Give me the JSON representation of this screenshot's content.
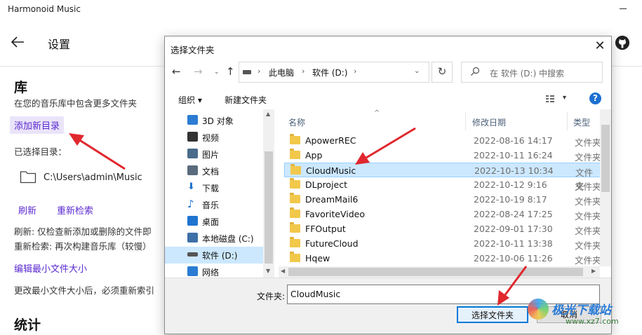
{
  "app": {
    "title": "Harmonoid Music",
    "page_title": "设置"
  },
  "library": {
    "heading": "库",
    "description": "在您的音乐库中包含更多文件夹",
    "add_button": "添加新目录",
    "selected_label": "已选择目录：",
    "directory_path": "C:\\Users\\admin\\Music",
    "refresh_button": "刷新",
    "rescan_button": "重新检索",
    "refresh_desc": "刷新: 仅检查新添加或删除的文件即",
    "rescan_desc": "重新检索: 再次构建音乐库（较慢）",
    "edit_min_button": "编辑最小文件大小",
    "min_desc": "更改最小文件大小后，必须重新索引",
    "stats_heading": "统计"
  },
  "dialog": {
    "title": "选择文件夹",
    "breadcrumbs": [
      "此电脑",
      "软件 (D:)"
    ],
    "search_placeholder": "在 软件 (D:) 中搜索",
    "toolbar": {
      "organize": "组织 ▾",
      "new_folder": "新建文件夹"
    },
    "tree": [
      {
        "label": "3D 对象",
        "icon": "3d-objects-icon",
        "color": "#2b7cd3"
      },
      {
        "label": "视频",
        "icon": "video-icon",
        "color": "#333333"
      },
      {
        "label": "图片",
        "icon": "pictures-icon",
        "color": "#4a6b8a"
      },
      {
        "label": "文档",
        "icon": "documents-icon",
        "color": "#5a6b7d"
      },
      {
        "label": "下载",
        "icon": "download-icon",
        "color": "#1f74d0"
      },
      {
        "label": "音乐",
        "icon": "music-icon",
        "color": "#1f74d0"
      },
      {
        "label": "桌面",
        "icon": "desktop-icon",
        "color": "#1f74d0"
      },
      {
        "label": "本地磁盘 (C:)",
        "icon": "local-disk-icon",
        "color": "#3d6fa8"
      },
      {
        "label": "软件 (D:)",
        "icon": "drive-icon",
        "color": "#555555",
        "selected": true
      },
      {
        "label": "网络",
        "icon": "network-icon",
        "color": "#2b7cd3"
      }
    ],
    "columns": {
      "name": "名称",
      "date": "修改日期",
      "type": "类型"
    },
    "files": [
      {
        "name": "ApowerREC",
        "date": "2022-08-16 14:17",
        "type": "文件夹"
      },
      {
        "name": "App",
        "date": "2022-10-11 16:24",
        "type": "文件夹"
      },
      {
        "name": "CloudMusic",
        "date": "2022-10-13 10:34",
        "type": "文件夹",
        "selected": true
      },
      {
        "name": "DLproject",
        "date": "2022-10-12 9:16",
        "type": "文件夹"
      },
      {
        "name": "DreamMail6",
        "date": "2022-10-19 8:17",
        "type": "文件夹"
      },
      {
        "name": "FavoriteVideo",
        "date": "2022-08-24 17:25",
        "type": "文件夹"
      },
      {
        "name": "FFOutput",
        "date": "2022-09-01 17:30",
        "type": "文件夹"
      },
      {
        "name": "FutureCloud",
        "date": "2022-10-11 13:38",
        "type": "文件夹"
      },
      {
        "name": "Hqew",
        "date": "2022-10-06 11:26",
        "type": "文件夹"
      }
    ],
    "folder_label": "文件夹:",
    "folder_value": "CloudMusic",
    "select_button": "选择文件夹",
    "cancel_button": "取消"
  },
  "watermark": {
    "text": "极光下载站",
    "url": "www.xz7.com"
  },
  "colors": {
    "accent": "#5b2ad0",
    "annotation": "#e0282e",
    "selection": "#cce8ff"
  }
}
